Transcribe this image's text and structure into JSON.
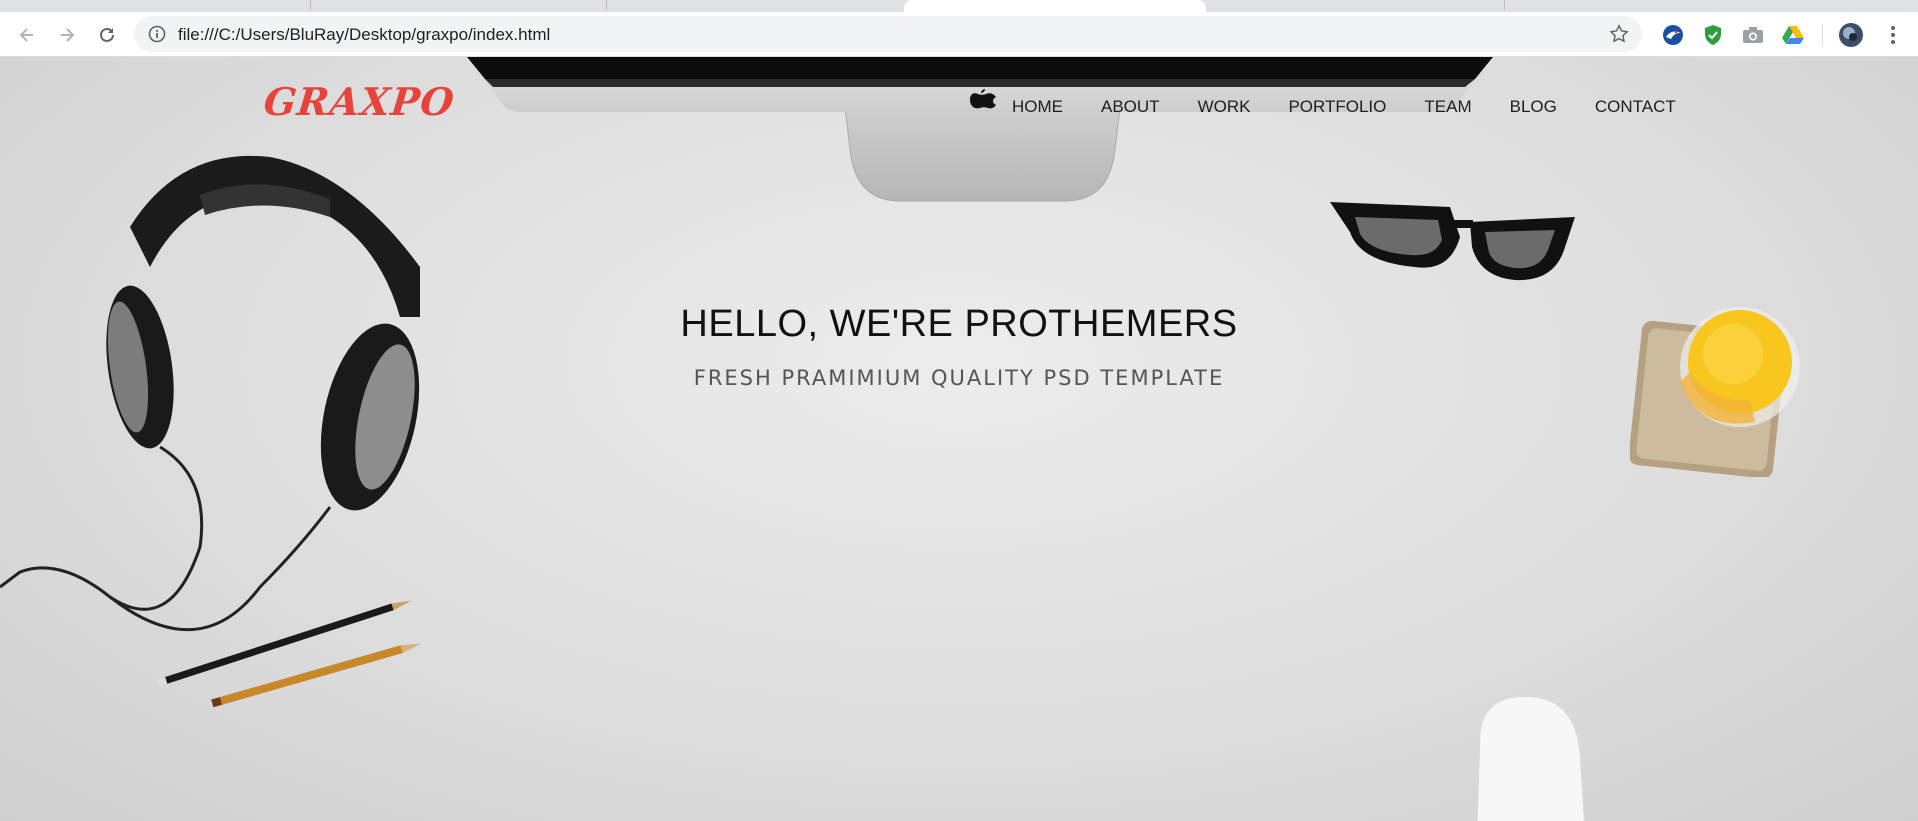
{
  "browser": {
    "url": "file:///C:/Users/BluRay/Desktop/graxpo/index.html",
    "icons": {
      "back": "arrow-left-icon",
      "forward": "arrow-right-icon",
      "reload": "reload-icon",
      "info": "info-icon",
      "bookmark": "star-icon",
      "menu": "kebab-menu-icon"
    },
    "extensions": [
      "bird-extension-icon",
      "shield-extension-icon",
      "camera-extension-icon",
      "drive-extension-icon"
    ]
  },
  "site": {
    "logo": "GRAXPO",
    "logo_color": "#e8433a",
    "nav": [
      "HOME",
      "ABOUT",
      "WORK",
      "PORTFOLIO",
      "TEAM",
      "BLOG",
      "CONTACT"
    ],
    "hero": {
      "title": "HELLO, WE'RE PROTHEMERS",
      "subtitle": "FRESH PRAMIMIUM QUALITY PSD TEMPLATE"
    },
    "decor": [
      "imac",
      "headphones",
      "glasses",
      "orange-juice",
      "pencils",
      "mouse"
    ]
  }
}
